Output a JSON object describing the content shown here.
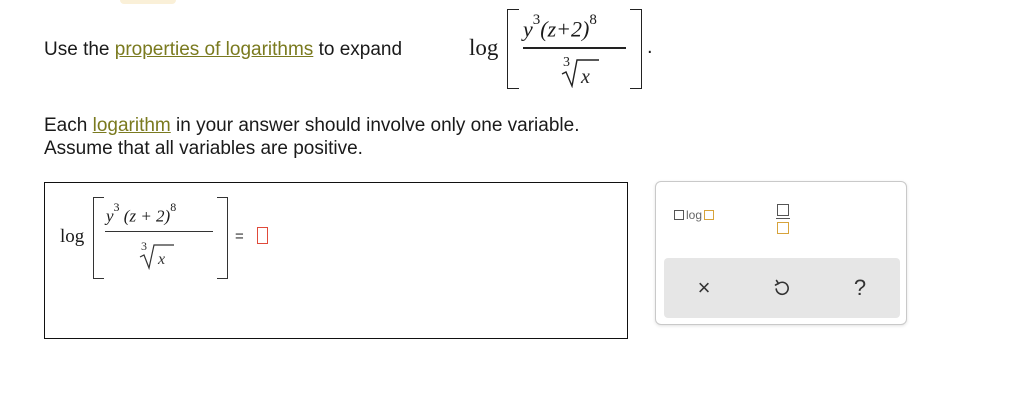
{
  "question": {
    "prefix": "Use the ",
    "link": "properties of logarithms",
    "suffix": " to expand ",
    "log": "log",
    "end": "."
  },
  "expression": {
    "numerator_base": "y",
    "numerator_base_exp": "3",
    "numerator_paren": "(z+2)",
    "numerator_paren_exp": "8",
    "root_index": "3",
    "radicand": "x"
  },
  "instructions": {
    "line1_prefix": "Each ",
    "line1_link": "logarithm",
    "line1_suffix": " in your answer should involve only one variable.",
    "line2": "Assume that all variables are positive."
  },
  "answer": {
    "log": "log",
    "numerator_base": "y",
    "numerator_base_exp": "3",
    "numerator_paren": "(z + 2)",
    "numerator_paren_exp": "8",
    "root_index": "3",
    "radicand": "x",
    "equals": "="
  },
  "palette": {
    "log_label": "log",
    "clear": "×",
    "help": "?",
    "icons": [
      "log-template-icon",
      "fraction-template-icon",
      "clear-icon",
      "undo-icon",
      "help-icon"
    ]
  },
  "colors": {
    "link": "#7a7a1f",
    "input_border": "#e04a3a",
    "template_accent": "#d7a33b",
    "action_bar": "#e6e6e6"
  }
}
